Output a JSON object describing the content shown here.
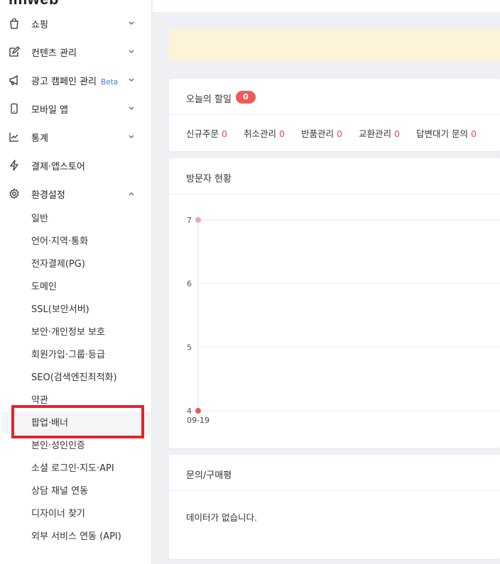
{
  "sidebar": {
    "logo": "imweb",
    "menu": [
      {
        "label": "쇼핑",
        "icon": "shopping-bag-icon",
        "chevron": "down"
      },
      {
        "label": "컨텐츠 관리",
        "icon": "edit-icon",
        "chevron": "down"
      },
      {
        "label": "광고 캠페인 관리",
        "beta": "Beta",
        "icon": "megaphone-icon",
        "chevron": "down"
      },
      {
        "label": "모바일 앱",
        "icon": "mobile-icon",
        "chevron": "down"
      },
      {
        "label": "통계",
        "icon": "chart-trend-icon",
        "chevron": "down"
      },
      {
        "label": "결제·앱스토어",
        "icon": "lightning-icon",
        "chevron": ""
      },
      {
        "label": "환경설정",
        "icon": "gear-icon",
        "chevron": "up"
      }
    ],
    "settings_sub": [
      "일반",
      "언어·지역·통화",
      "전자결제(PG)",
      "도메인",
      "SSL(보안서버)",
      "보안·개인정보 보호",
      "회원가입·그룹·등급",
      "SEO(검색엔진최적화)",
      "약관",
      "팝업·배너",
      "본인·성인인증",
      "소셜 로그인·지도·API",
      "상담 채널 연동",
      "디자이너 찾기",
      "외부 서비스 연동 (API)"
    ],
    "active_sub": "팝업·배너"
  },
  "today": {
    "title": "오늘의 할일",
    "badge": "0",
    "stats": [
      {
        "label": "신규주문",
        "value": "0"
      },
      {
        "label": "취소관리",
        "value": "0"
      },
      {
        "label": "반품관리",
        "value": "0"
      },
      {
        "label": "교환관리",
        "value": "0"
      },
      {
        "label": "답변대기 문의",
        "value": "0"
      }
    ]
  },
  "visitors": {
    "title": "방문자 현황"
  },
  "chart_data": {
    "type": "line",
    "x": [
      "09-19"
    ],
    "series": [
      {
        "values": [
          4
        ],
        "color": "#f05a5a"
      },
      {
        "values": [
          7
        ],
        "color": "#f5a9ad"
      }
    ],
    "yticks": [
      "7",
      "6",
      "5",
      "4"
    ],
    "ylim": [
      4,
      7
    ],
    "grid": true
  },
  "inquiry": {
    "title": "문의/구매평",
    "empty": "데이터가 없습니다."
  },
  "colors": {
    "accent_red": "#e84a4a",
    "beta_blue": "#3a7de0",
    "notice_bg": "#fdf3d7"
  }
}
